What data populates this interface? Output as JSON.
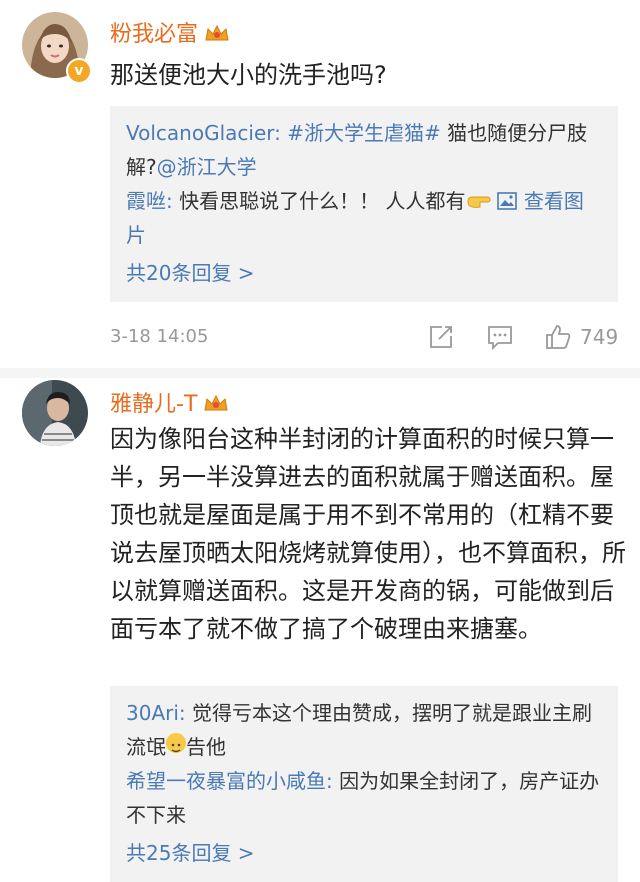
{
  "comment1": {
    "username": "粉我必富",
    "verified_badge": "v",
    "text": "那送便池大小的洗手池吗?",
    "replies": [
      {
        "name": "VolcanoGlacier:",
        "topic": "#浙大学生虐猫#",
        "text_after_topic": " 猫也随便分尸肢解?",
        "mention": "@浙江大学"
      },
      {
        "name": "霞咝:",
        "text": " 快看思聪说了什么！！ 人人都有",
        "view_image": "查看图片"
      }
    ],
    "reply_count": "共20条回复 >",
    "time": "3-18 14:05",
    "like_count": "749"
  },
  "comment2": {
    "username": "雅静儿-T",
    "text": "因为像阳台这种半封闭的计算面积的时候只算一半，另一半没算进去的面积就属于赠送面积。屋顶也就是屋面是属于用不到不常用的（杠精不要说去屋顶晒太阳烧烤就算使用），也不算面积，所以就算赠送面积。这是开发商的锅，可能做到后面亏本了就不做了搞了个破理由来搪塞。",
    "replies": [
      {
        "name": "30Ari:",
        "text_before_emoji": " 觉得亏本这个理由赞成，摆明了就是跟业主刷流氓",
        "text_after_emoji": "告他"
      },
      {
        "name": "希望一夜暴富的小咸鱼:",
        "text": " 因为如果全封闭了，房产证办不下来"
      }
    ],
    "reply_count": "共25条回复 >"
  },
  "icons": {
    "crown": "crown-badge-icon",
    "repost": "repost-icon",
    "comment": "comment-icon",
    "like": "thumbs-up-icon",
    "image": "image-icon",
    "emoji_hand": "pointing-hand-emoji",
    "emoji_face": "face-emoji"
  },
  "colors": {
    "username": "#e86c1e",
    "link_blue": "#4a7ab5",
    "reply_bg": "#f2f2f2"
  }
}
